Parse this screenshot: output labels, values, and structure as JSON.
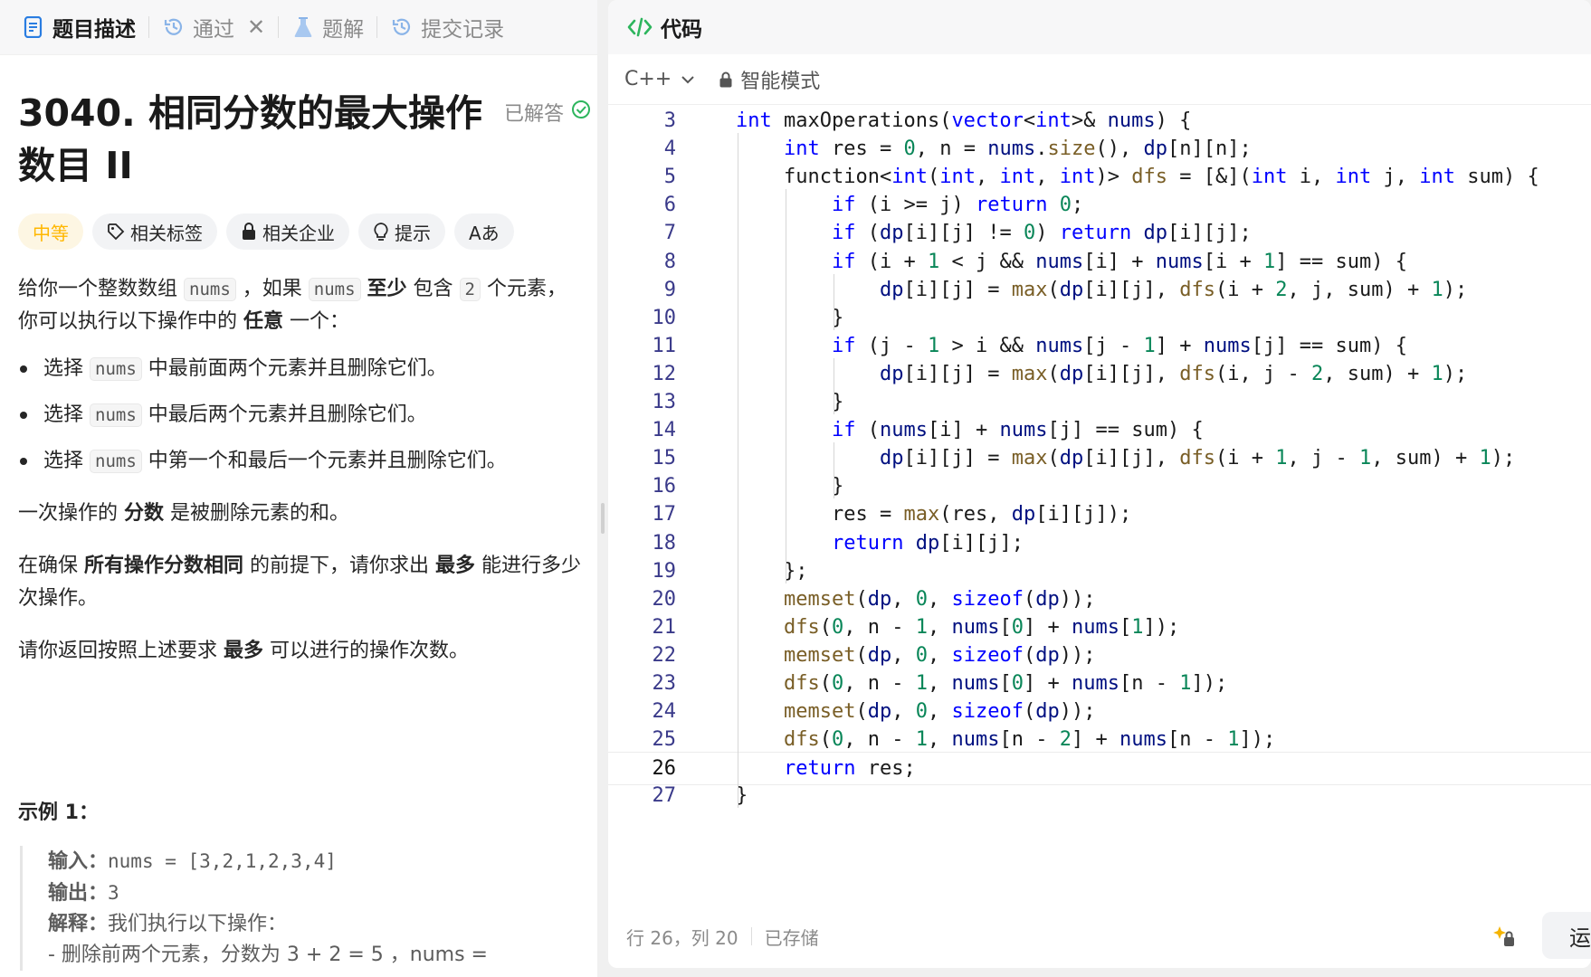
{
  "left_tabs": [
    {
      "label": "题目描述",
      "icon": "description-icon"
    },
    {
      "label": "通过",
      "icon": "history-icon"
    },
    {
      "label": "题解",
      "icon": "flask-icon"
    },
    {
      "label": "提交记录",
      "icon": "history-icon"
    }
  ],
  "problem": {
    "title": "3040. 相同分数的最大操作数目 II",
    "status": "已解答",
    "tags": {
      "difficulty": "中等",
      "related_tags": "相关标签",
      "related_companies": "相关企业",
      "hint": "提示",
      "font_toggle": "Aあ"
    }
  },
  "description": {
    "p1_a": "给你一个整数数组 ",
    "p1_code1": "nums",
    "p1_b": " ，如果 ",
    "p1_code2": "nums",
    "p1_c": " ",
    "p1_bold1": "至少",
    "p1_d": " 包含 ",
    "p1_code3": "2",
    "p1_e": " 个元素，你可以执行以下操作中的 ",
    "p1_bold2": "任意",
    "p1_f": " 一个：",
    "bullets": [
      {
        "a": "选择 ",
        "code": "nums",
        "b": " 中最前面两个元素并且删除它们。"
      },
      {
        "a": "选择 ",
        "code": "nums",
        "b": " 中最后两个元素并且删除它们。"
      },
      {
        "a": "选择 ",
        "code": "nums",
        "b": " 中第一个和最后一个元素并且删除它们。"
      }
    ],
    "p2_a": "一次操作的 ",
    "p2_bold": "分数",
    "p2_b": " 是被删除元素的和。",
    "p3_a": "在确保 ",
    "p3_bold1": "所有操作分数相同",
    "p3_b": " 的前提下，请你求出 ",
    "p3_bold2": "最多",
    "p3_c": " 能进行多少次操作。",
    "p4_a": "请你返回按照上述要求 ",
    "p4_bold": "最多",
    "p4_b": " 可以进行的操作次数。"
  },
  "example": {
    "title": "示例 1：",
    "input_label": "输入：",
    "input_value": "nums = [3,2,1,2,3,4]",
    "output_label": "输出：",
    "output_value": "3",
    "explain_label": "解释：",
    "explain_value": "我们执行以下操作：",
    "step1": "- 删除前两个元素，分数为 3 + 2 = 5 ，nums = "
  },
  "editor": {
    "header": "代码",
    "language": "C++",
    "mode": "智能模式",
    "current_line": 26,
    "code": [
      {
        "n": "3",
        "t": "int maxOperations(vector<int>& nums) {"
      },
      {
        "n": "4",
        "t": "int res = 0, n = nums.size(), dp[n][n];"
      },
      {
        "n": "5",
        "t": "function<int(int, int, int)> dfs = [&](int i, int j, int sum) {"
      },
      {
        "n": "6",
        "t": "if (i >= j) return 0;"
      },
      {
        "n": "7",
        "t": "if (dp[i][j] != 0) return dp[i][j];"
      },
      {
        "n": "8",
        "t": "if (i + 1 < j && nums[i] + nums[i + 1] == sum) {"
      },
      {
        "n": "9",
        "t": "dp[i][j] = max(dp[i][j], dfs(i + 2, j, sum) + 1);"
      },
      {
        "n": "10",
        "t": "}"
      },
      {
        "n": "11",
        "t": "if (j - 1 > i && nums[j - 1] + nums[j] == sum) {"
      },
      {
        "n": "12",
        "t": "dp[i][j] = max(dp[i][j], dfs(i, j - 2, sum) + 1);"
      },
      {
        "n": "13",
        "t": "}"
      },
      {
        "n": "14",
        "t": "if (nums[i] + nums[j] == sum) {"
      },
      {
        "n": "15",
        "t": "dp[i][j] = max(dp[i][j], dfs(i + 1, j - 1, sum) + 1);"
      },
      {
        "n": "16",
        "t": "}"
      },
      {
        "n": "17",
        "t": "res = max(res, dp[i][j]);"
      },
      {
        "n": "18",
        "t": "return dp[i][j];"
      },
      {
        "n": "19",
        "t": "};"
      },
      {
        "n": "20",
        "t": "memset(dp, 0, sizeof(dp));"
      },
      {
        "n": "21",
        "t": "dfs(0, n - 1, nums[0] + nums[1]);"
      },
      {
        "n": "22",
        "t": "memset(dp, 0, sizeof(dp));"
      },
      {
        "n": "23",
        "t": "dfs(0, n - 1, nums[0] + nums[n - 1]);"
      },
      {
        "n": "24",
        "t": "memset(dp, 0, sizeof(dp));"
      },
      {
        "n": "25",
        "t": "dfs(0, n - 1, nums[n - 2] + nums[n - 1]);"
      },
      {
        "n": "26",
        "t": "return res;"
      },
      {
        "n": "27",
        "t": "}"
      }
    ],
    "status": {
      "position": "行 26，列 20",
      "saved": "已存储"
    },
    "run_label": "运行"
  },
  "colors": {
    "keyword": "#0000ff",
    "function": "#795e26",
    "number": "#098658",
    "identifier": "#001080",
    "difficulty": "#ffb700",
    "solved_check": "#2db55d"
  }
}
